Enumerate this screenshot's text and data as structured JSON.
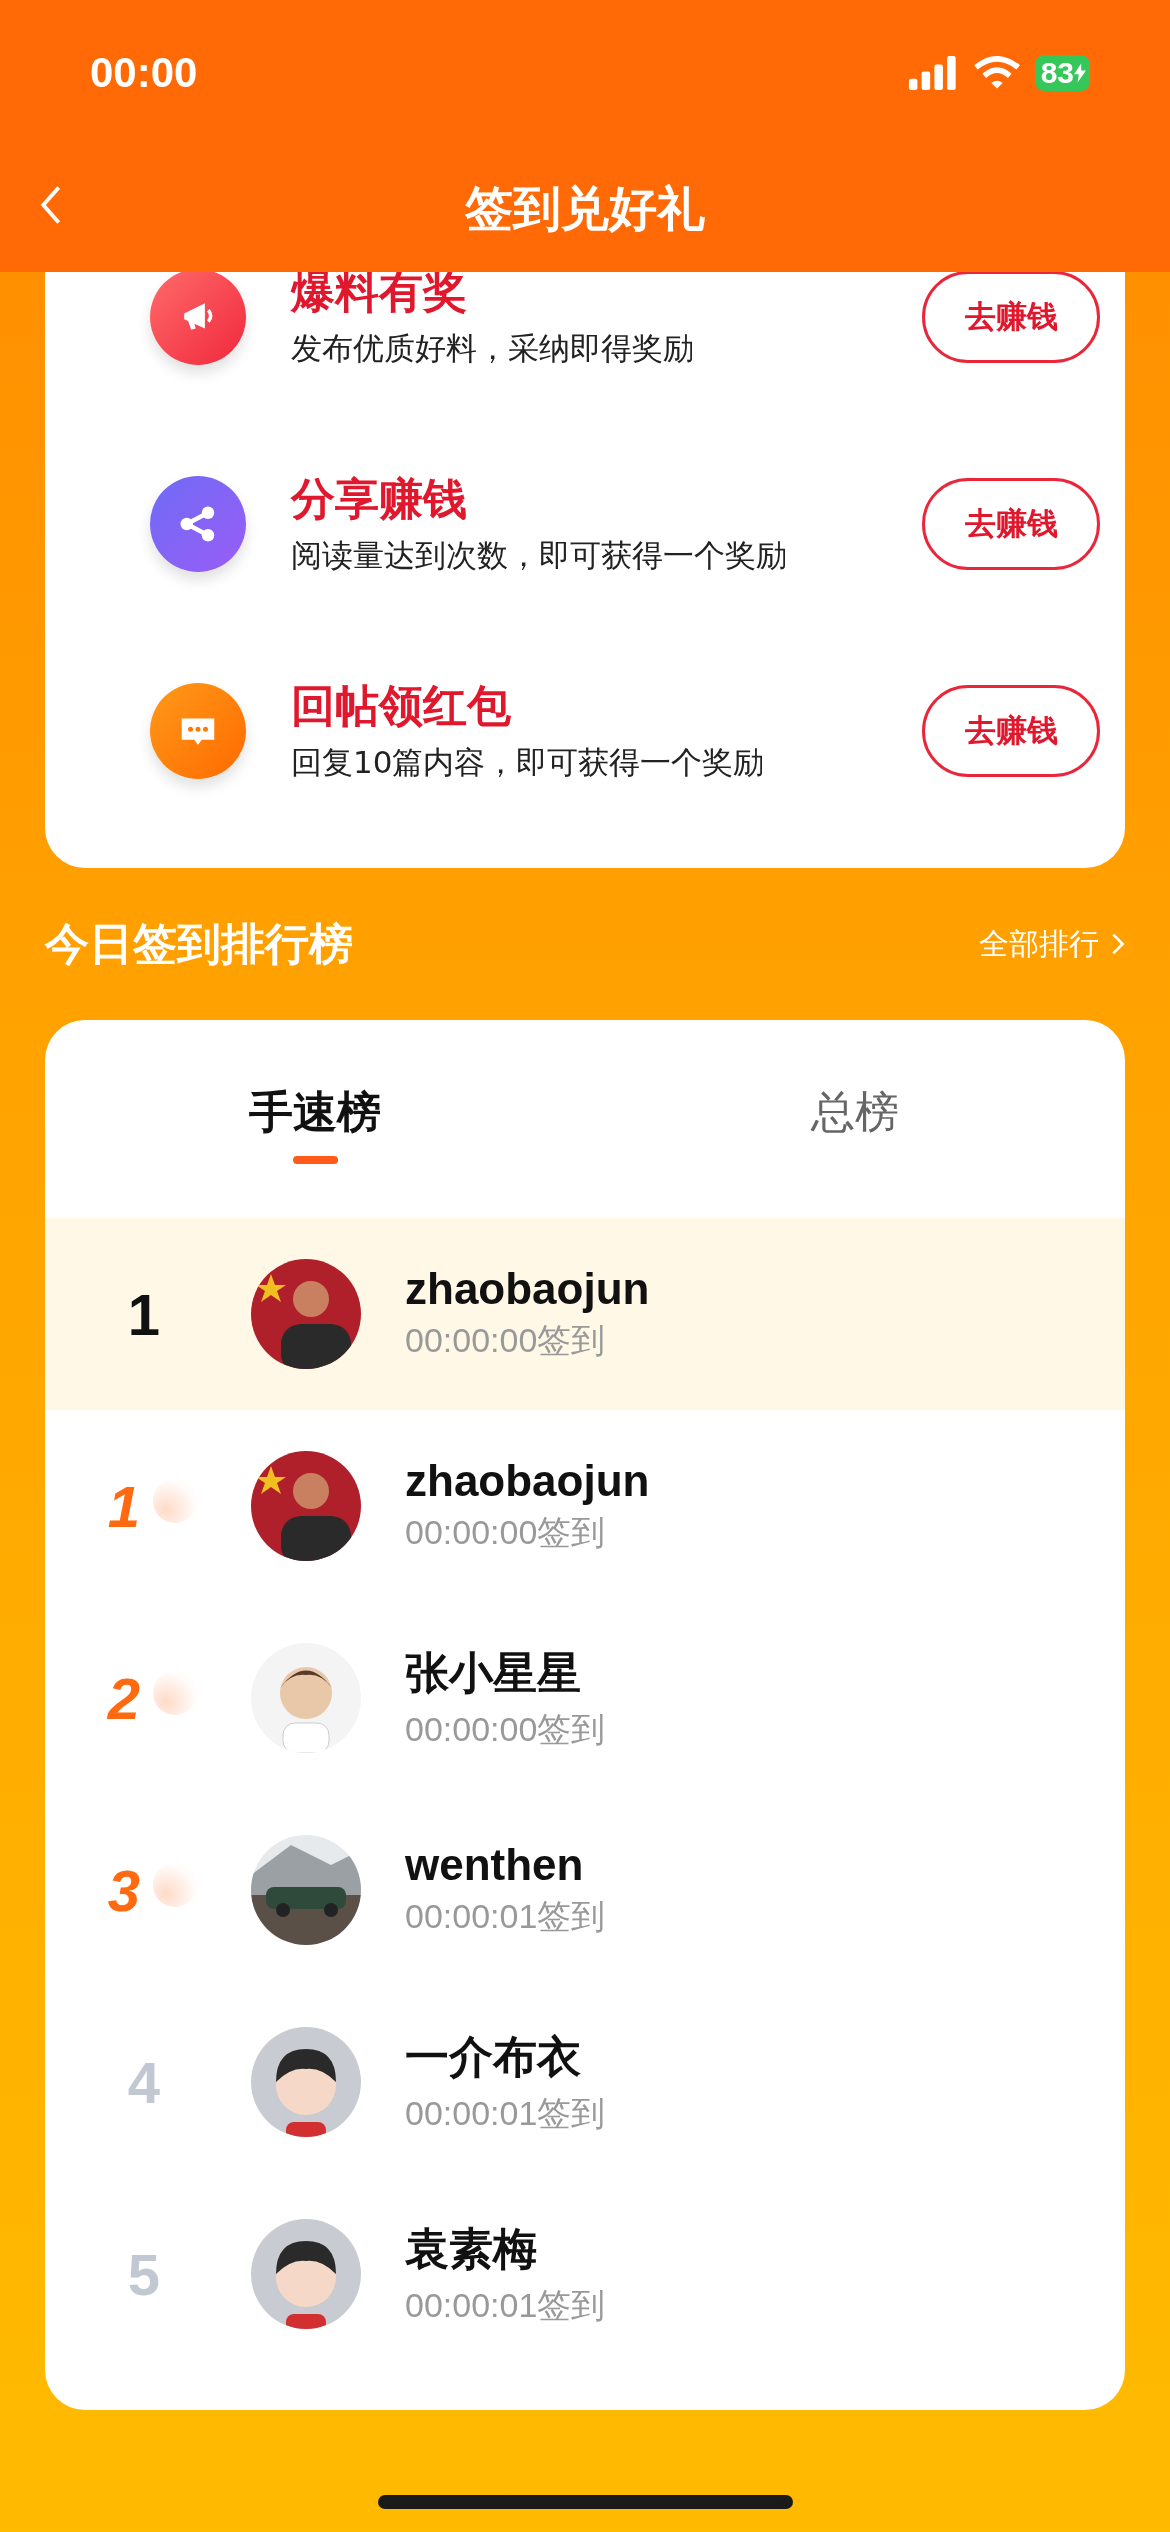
{
  "status_bar": {
    "time": "00:00",
    "battery": "83"
  },
  "nav": {
    "title": "签到兑好礼"
  },
  "tasks": [
    {
      "kind": "megaphone",
      "title": "爆料有奖",
      "desc": "发布优质好料，采纳即得奖励",
      "button": "去赚钱"
    },
    {
      "kind": "share",
      "title": "分享赚钱",
      "desc": "阅读量达到次数，即可获得一个奖励",
      "button": "去赚钱"
    },
    {
      "kind": "chat",
      "title": "回帖领红包",
      "desc": "回复10篇内容，即可获得一个奖励",
      "button": "去赚钱"
    }
  ],
  "ranking": {
    "title": "今日签到排行榜",
    "more": "全部排行",
    "tabs": [
      {
        "label": "手速榜",
        "selected": true
      },
      {
        "label": "总榜",
        "selected": false
      }
    ],
    "rows": [
      {
        "rank": "1",
        "kind": "mine",
        "name": "zhaobaojun",
        "time": "00:00:00签到"
      },
      {
        "rank": "1",
        "kind": "medal",
        "name": "zhaobaojun",
        "time": "00:00:00签到"
      },
      {
        "rank": "2",
        "kind": "medal",
        "name": "张小星星",
        "time": "00:00:00签到"
      },
      {
        "rank": "3",
        "kind": "medal",
        "name": "wenthen",
        "time": "00:00:01签到"
      },
      {
        "rank": "4",
        "kind": "plain",
        "name": "一介布衣",
        "time": "00:00:01签到"
      },
      {
        "rank": "5",
        "kind": "plain",
        "name": "袁素梅",
        "time": "00:00:01签到"
      }
    ]
  }
}
